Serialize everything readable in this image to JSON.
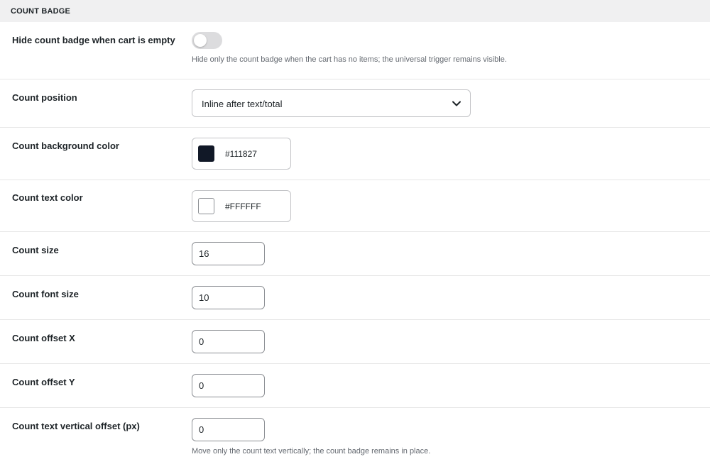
{
  "section": {
    "title": "COUNT BADGE"
  },
  "rows": {
    "hide_empty": {
      "label": "Hide count badge when cart is empty",
      "toggle_on": false,
      "help": "Hide only the count badge when the cart has no items; the universal trigger remains visible."
    },
    "position": {
      "label": "Count position",
      "selected": "Inline after text/total",
      "icon": "chevron-down-icon"
    },
    "bg_color": {
      "label": "Count background color",
      "swatch": "#111827",
      "hex": "#111827"
    },
    "text_color": {
      "label": "Count text color",
      "swatch": "#FFFFFF",
      "hex": "#FFFFFF"
    },
    "size": {
      "label": "Count size",
      "value": "16"
    },
    "font_size": {
      "label": "Count font size",
      "value": "10"
    },
    "offset_x": {
      "label": "Count offset X",
      "value": "0"
    },
    "offset_y": {
      "label": "Count offset Y",
      "value": "0"
    },
    "vertical_offset": {
      "label": "Count text vertical offset (px)",
      "value": "0",
      "help": "Move only the count text vertically; the count badge remains in place."
    }
  }
}
